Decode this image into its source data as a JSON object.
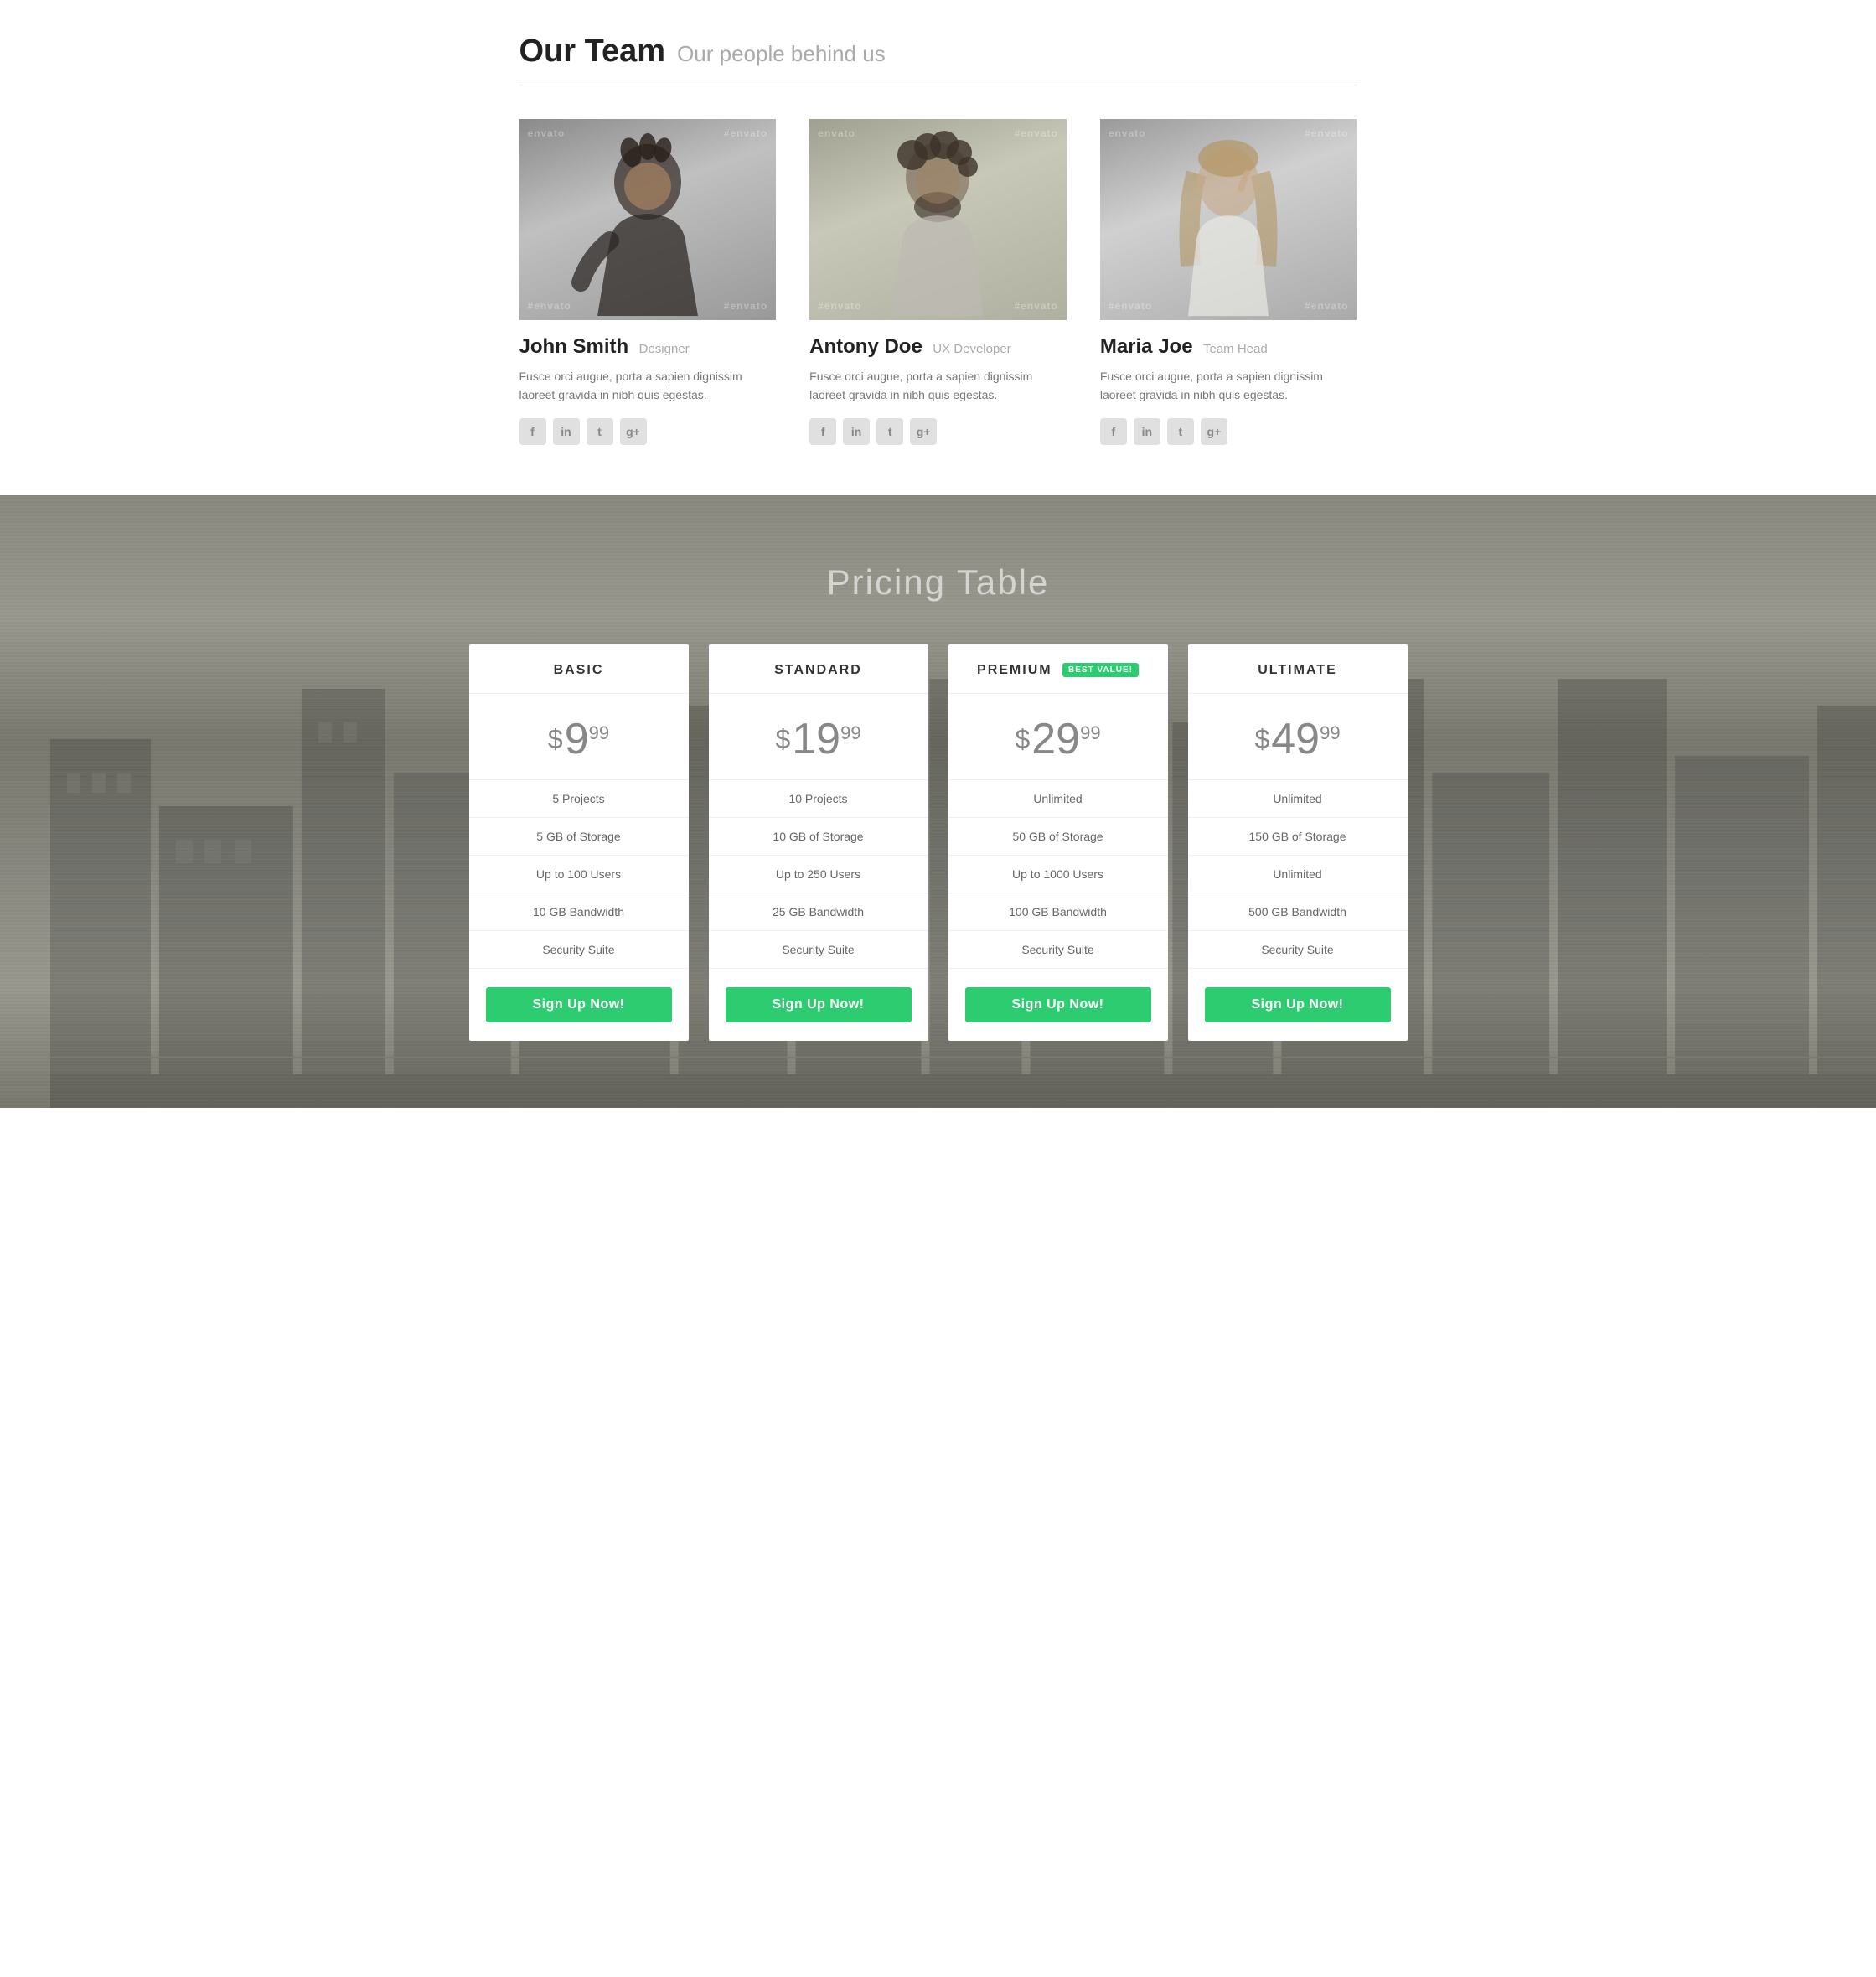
{
  "team_section": {
    "title_bold": "Our Team",
    "title_sub": "Our people behind us",
    "members": [
      {
        "name": "John Smith",
        "role": "Designer",
        "bio": "Fusce orci augue, porta a sapien dignissim laoreet gravida in nibh quis egestas.",
        "social": [
          "f",
          "in",
          "t",
          "g+"
        ]
      },
      {
        "name": "Antony Doe",
        "role": "UX Developer",
        "bio": "Fusce orci augue, porta a sapien dignissim laoreet gravida in nibh quis egestas.",
        "social": [
          "f",
          "in",
          "t",
          "g+"
        ]
      },
      {
        "name": "Maria Joe",
        "role": "Team Head",
        "bio": "Fusce orci augue, porta a sapien dignissim laoreet gravida in nibh quis egestas.",
        "social": [
          "f",
          "in",
          "t",
          "g+"
        ]
      }
    ]
  },
  "pricing_section": {
    "title": "Pricing Table",
    "plans": [
      {
        "name": "BASIC",
        "best_value": false,
        "price_symbol": "$",
        "price_main": "9",
        "price_cents": "99",
        "features": [
          "5 Projects",
          "5 GB of Storage",
          "Up to 100 Users",
          "10 GB Bandwidth",
          "Security Suite"
        ],
        "cta": "Sign Up Now!"
      },
      {
        "name": "STANDARD",
        "best_value": false,
        "price_symbol": "$",
        "price_main": "19",
        "price_cents": "99",
        "features": [
          "10 Projects",
          "10 GB of Storage",
          "Up to 250 Users",
          "25 GB Bandwidth",
          "Security Suite"
        ],
        "cta": "Sign Up Now!"
      },
      {
        "name": "PREMIUM",
        "best_value": true,
        "best_value_label": "BEST VALUE!",
        "price_symbol": "$",
        "price_main": "29",
        "price_cents": "99",
        "features": [
          "Unlimited",
          "50 GB of Storage",
          "Up to 1000 Users",
          "100 GB Bandwidth",
          "Security Suite"
        ],
        "cta": "Sign Up Now!"
      },
      {
        "name": "ULTIMATE",
        "best_value": false,
        "price_symbol": "$",
        "price_main": "49",
        "price_cents": "99",
        "features": [
          "Unlimited",
          "150 GB of Storage",
          "Unlimited",
          "500 GB Bandwidth",
          "Security Suite"
        ],
        "cta": "Sign Up Now!"
      }
    ]
  }
}
